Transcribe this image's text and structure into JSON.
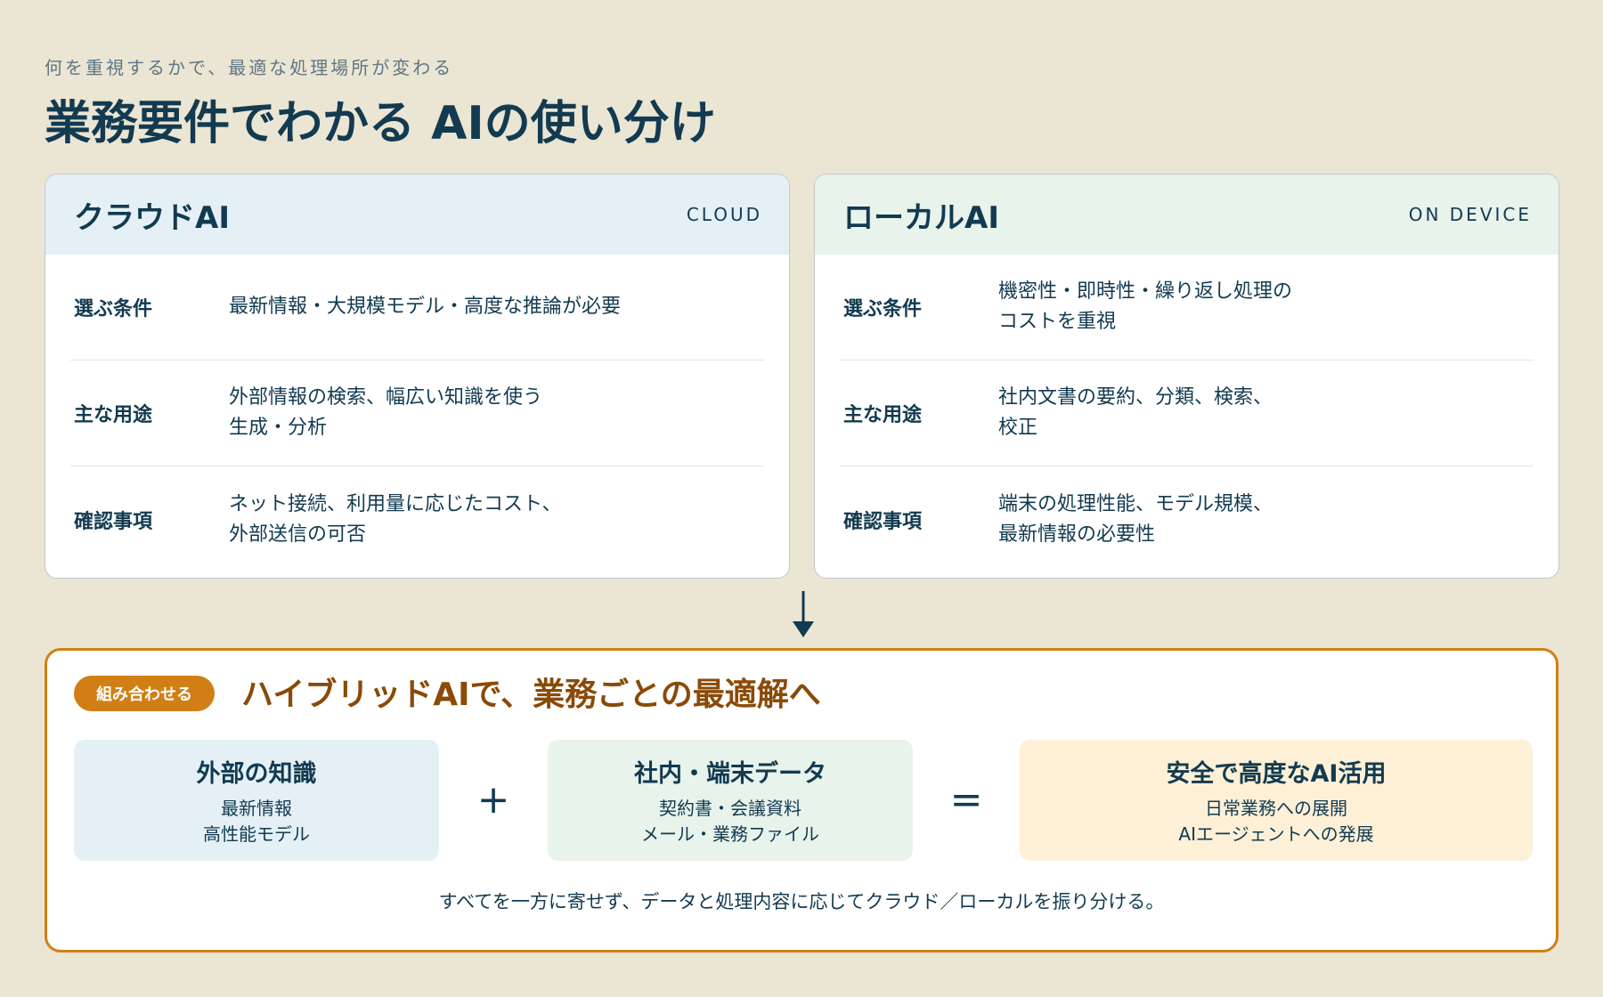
{
  "header": {
    "subtitle": "何を重視するかで、最適な処理場所が変わる",
    "title": "業務要件でわかる AIの使い分け"
  },
  "cards": [
    {
      "title": "クラウドAI",
      "tag": "CLOUD",
      "rows": [
        {
          "label": "選ぶ条件",
          "text": "最新情報・大規模モデル・高度な推論が必要"
        },
        {
          "label": "主な用途",
          "text": "外部情報の検索、幅広い知識を使う\n生成・分析"
        },
        {
          "label": "確認事項",
          "text": "ネット接続、利用量に応じたコスト、\n外部送信の可否"
        }
      ]
    },
    {
      "title": "ローカルAI",
      "tag": "ON DEVICE",
      "rows": [
        {
          "label": "選ぶ条件",
          "text": "機密性・即時性・繰り返し処理の\nコストを重視"
        },
        {
          "label": "主な用途",
          "text": "社内文書の要約、分類、検索、\n校正"
        },
        {
          "label": "確認事項",
          "text": "端末の処理性能、モデル規模、\n最新情報の必要性"
        }
      ]
    }
  ],
  "hybrid": {
    "badge": "組み合わせる",
    "title": "ハイブリッドAIで、業務ごとの最適解へ",
    "boxes": [
      {
        "title": "外部の知識",
        "lines": [
          "最新情報",
          "高性能モデル"
        ]
      },
      {
        "title": "社内・端末データ",
        "lines": [
          "契約書・会議資料",
          "メール・業務ファイル"
        ]
      },
      {
        "title": "安全で高度なAI活用",
        "lines": [
          "日常業務への展開",
          "AIエージェントへの発展"
        ]
      }
    ],
    "plus": "+",
    "equals": "=",
    "note": "すべてを一方に寄せず、データと処理内容に応じてクラウド／ローカルを振り分ける。"
  },
  "colors": {
    "background": "#ebe5d3",
    "navy": "#123a50",
    "accent_orange": "#d17f15",
    "cloud_header": "#e4f0f6",
    "local_header": "#e8f3eb",
    "result_box": "#fdf0d6"
  },
  "icons": {
    "flow_arrow": "arrow-down-icon"
  }
}
